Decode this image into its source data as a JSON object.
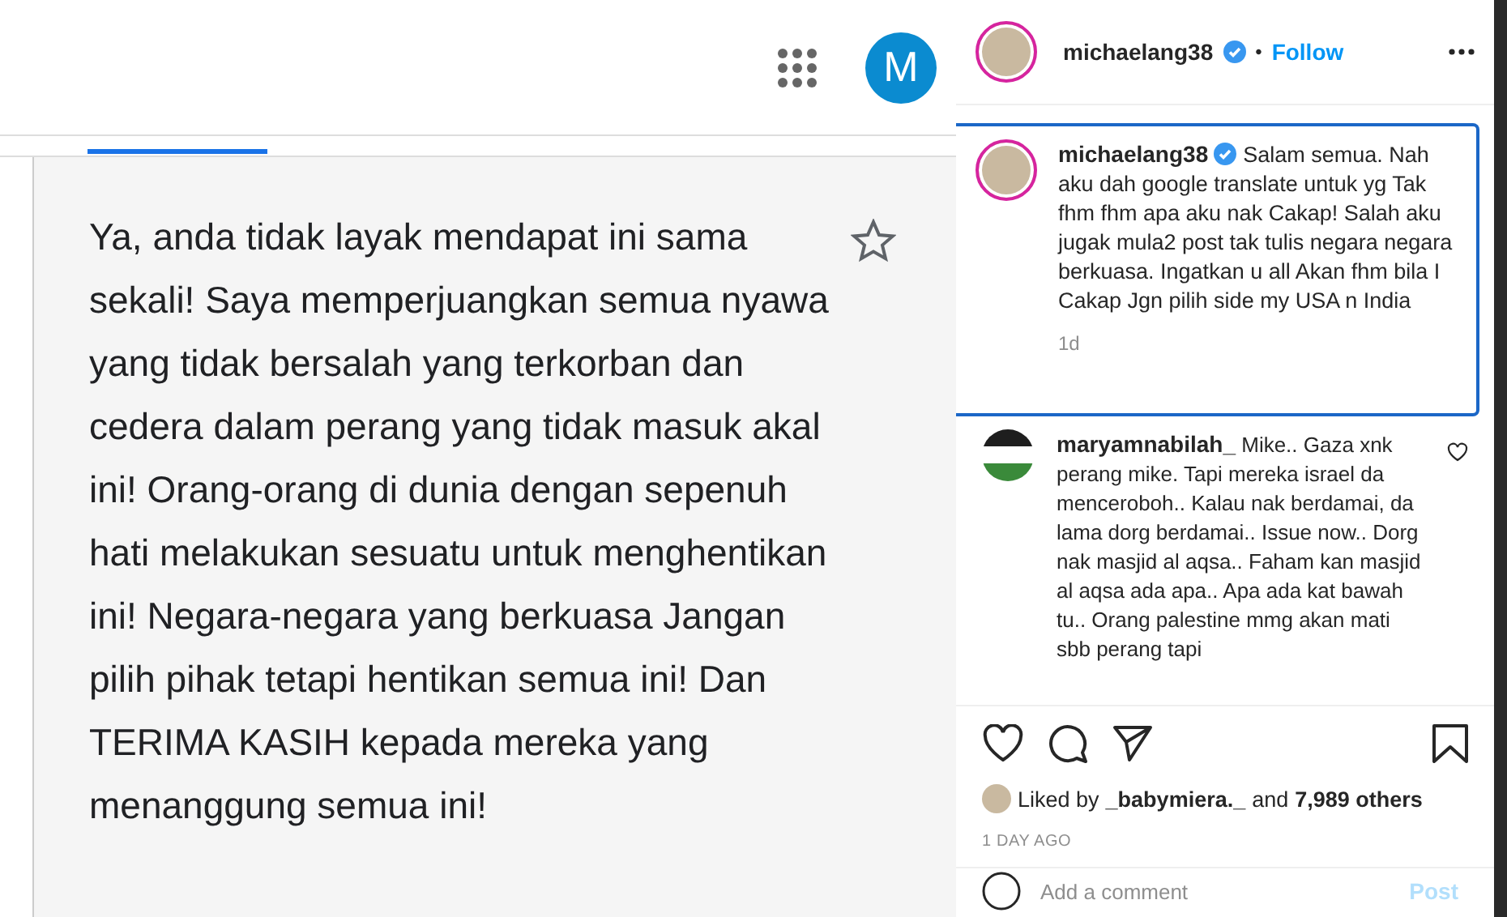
{
  "translate_screenshot": {
    "avatar_letter": "M",
    "tab_selected": true,
    "translation": "Ya, anda tidak layak mendapat ini sama sekali! Saya memperjuangkan semua nyawa yang tidak bersalah yang terkorban dan cedera dalam perang yang tidak masuk akal ini! Orang-orang di dunia dengan sepenuh hati melakukan sesuatu untuk menghentikan ini! Negara-negara yang berkuasa Jangan pilih pihak tetapi hentikan semua ini! Dan TERIMA KASIH kepada mereka yang menanggung semua ini!"
  },
  "post_header": {
    "username": "michaelang38",
    "verified": true,
    "separator": "•",
    "follow": "Follow"
  },
  "caption": {
    "username": "michaelang38",
    "verified": true,
    "text": "Salam semua. Nah aku dah google translate untuk yg Tak fhm fhm apa aku nak Cakap! Salah aku jugak mula2 post tak tulis negara negara berkuasa. Ingatkan u all Akan fhm bila I Cakap Jgn pilih side my USA n India",
    "time": "1d"
  },
  "comments": [
    {
      "username": "maryamnabilah_",
      "text": "Mike.. Gaza xnk perang mike. Tapi mereka israel da menceroboh.. Kalau nak berdamai, da lama dorg berdamai.. Issue now.. Dorg nak masjid al aqsa.. Faham kan masjid al aqsa ada apa.. Apa ada kat bawah tu.. Orang palestine mmg akan mati sbb perang tapi",
      "liked": false
    }
  ],
  "likes": {
    "prefix": "Liked by",
    "user": "_babymiera._",
    "middle": "and",
    "count": "7,989 others"
  },
  "date": "1 DAY AGO",
  "comment_box": {
    "placeholder": "Add a comment",
    "post": "Post"
  }
}
